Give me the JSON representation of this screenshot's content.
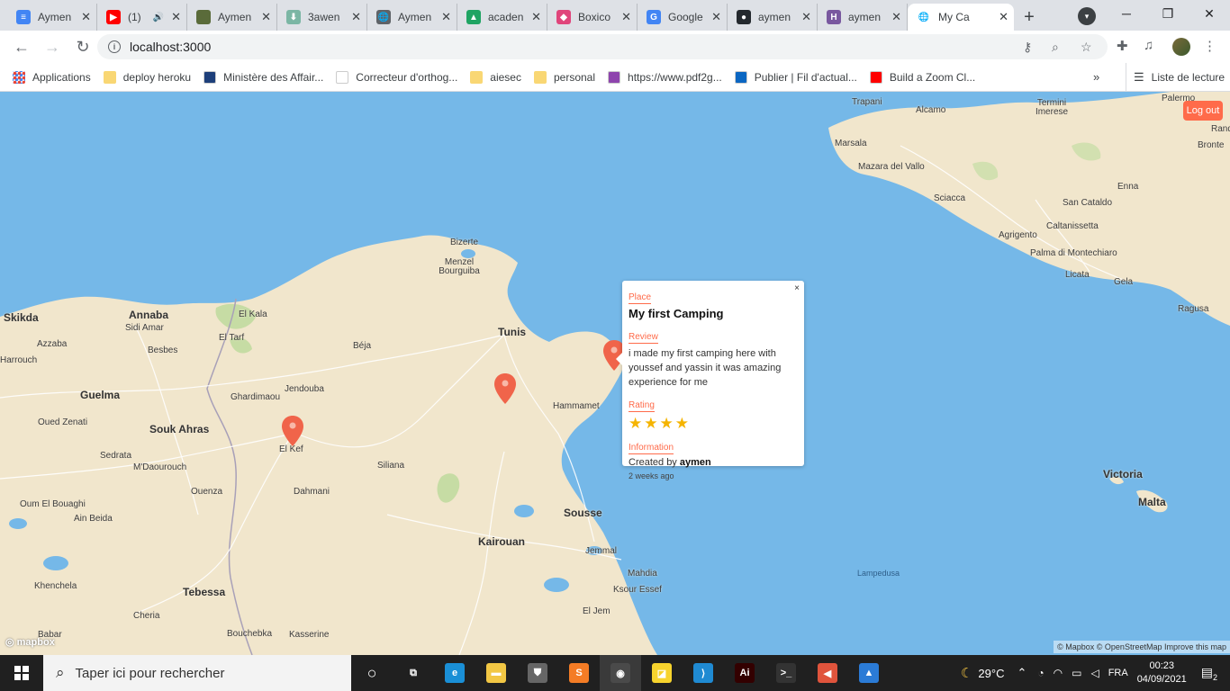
{
  "browser": {
    "tabs": [
      {
        "title": "Aymen",
        "fav_color": "#4285f4",
        "fav_glyph": "≡"
      },
      {
        "title": "(1)",
        "fav_color": "#ff0000",
        "fav_glyph": "▶",
        "audio": "🔊"
      },
      {
        "title": "Aymen",
        "fav_color": "#5a6b3a",
        "fav_glyph": ""
      },
      {
        "title": "3awen",
        "fav_color": "#7bb6a4",
        "fav_glyph": "⬇"
      },
      {
        "title": "Aymen",
        "fav_color": "#5f6368",
        "fav_glyph": "🌐"
      },
      {
        "title": "acaden",
        "fav_color": "#1fa463",
        "fav_glyph": "▲"
      },
      {
        "title": "Boxico",
        "fav_color": "#e0457b",
        "fav_glyph": "◆"
      },
      {
        "title": "Google",
        "fav_color": "#4285f4",
        "fav_glyph": "G"
      },
      {
        "title": "aymen",
        "fav_color": "#24292e",
        "fav_glyph": "●"
      },
      {
        "title": "aymen",
        "fav_color": "#79589f",
        "fav_glyph": "H"
      }
    ],
    "active_tab": {
      "title": "My Ca",
      "fav_glyph": "🌐"
    },
    "new_tab": "+",
    "tab_close": "✕",
    "url": "localhost:3000",
    "window_controls": {
      "minimize": "─",
      "restore": "❐",
      "close": "✕"
    }
  },
  "bookmarks": {
    "items": [
      {
        "label": "Applications",
        "kind": "apps"
      },
      {
        "label": "deploy heroku",
        "kind": "folder"
      },
      {
        "label": "Ministère des Affair...",
        "kind": "site",
        "color": "#1d3f7a"
      },
      {
        "label": "Correcteur d'orthog...",
        "kind": "site",
        "color": "#ffffff"
      },
      {
        "label": "aiesec",
        "kind": "folder"
      },
      {
        "label": "personal",
        "kind": "folder"
      },
      {
        "label": "https://www.pdf2g...",
        "kind": "site",
        "color": "#8e44ad"
      },
      {
        "label": "Publier | Fil d'actual...",
        "kind": "site",
        "color": "#0a66c2"
      },
      {
        "label": "Build a Zoom Cl...",
        "kind": "site",
        "color": "#ff0000"
      }
    ],
    "more": "»",
    "reading_list": "Liste de lecture"
  },
  "map": {
    "logout_label": "Log out",
    "places": [
      {
        "name": "Trapani",
        "cls": ""
      },
      {
        "name": "Alcamo",
        "cls": ""
      },
      {
        "name": "Termini Imerese",
        "cls": ""
      },
      {
        "name": "Palermo",
        "cls": ""
      },
      {
        "name": "Randa",
        "cls": ""
      },
      {
        "name": "Bronte",
        "cls": ""
      },
      {
        "name": "Marsala",
        "cls": ""
      },
      {
        "name": "Mazara del Vallo",
        "cls": ""
      },
      {
        "name": "Enna",
        "cls": ""
      },
      {
        "name": "Sciacca",
        "cls": ""
      },
      {
        "name": "San Cataldo",
        "cls": ""
      },
      {
        "name": "Caltanissetta",
        "cls": ""
      },
      {
        "name": "Agrigento",
        "cls": ""
      },
      {
        "name": "Palma di Montechiaro",
        "cls": ""
      },
      {
        "name": "Licata",
        "cls": ""
      },
      {
        "name": "Gela",
        "cls": ""
      },
      {
        "name": "Ragusa",
        "cls": ""
      },
      {
        "name": "Bizerte",
        "cls": ""
      },
      {
        "name": "Menzel Bourguiba",
        "cls": ""
      },
      {
        "name": "Skikda",
        "cls": "big"
      },
      {
        "name": "Annaba",
        "cls": "big"
      },
      {
        "name": "Sidi Amar",
        "cls": ""
      },
      {
        "name": "El Kala",
        "cls": ""
      },
      {
        "name": "El Tarf",
        "cls": ""
      },
      {
        "name": "Azzaba",
        "cls": ""
      },
      {
        "name": "Besbes",
        "cls": ""
      },
      {
        "name": "Béja",
        "cls": ""
      },
      {
        "name": "Tunis",
        "cls": "big"
      },
      {
        "name": "Harrouch",
        "cls": ""
      },
      {
        "name": "Guelma",
        "cls": "big"
      },
      {
        "name": "Ghardimaou",
        "cls": ""
      },
      {
        "name": "Jendouba",
        "cls": ""
      },
      {
        "name": "Hammamet",
        "cls": ""
      },
      {
        "name": "Oued Zenati",
        "cls": ""
      },
      {
        "name": "Souk Ahras",
        "cls": "big"
      },
      {
        "name": "El Kef",
        "cls": ""
      },
      {
        "name": "Sedrata",
        "cls": ""
      },
      {
        "name": "M'Daourouch",
        "cls": ""
      },
      {
        "name": "Siliana",
        "cls": ""
      },
      {
        "name": "Dahmani",
        "cls": ""
      },
      {
        "name": "Ouenza",
        "cls": ""
      },
      {
        "name": "Oum El Bouaghi",
        "cls": ""
      },
      {
        "name": "Ain Beida",
        "cls": ""
      },
      {
        "name": "Sousse",
        "cls": "big"
      },
      {
        "name": "Kairouan",
        "cls": "big"
      },
      {
        "name": "Jemmal",
        "cls": ""
      },
      {
        "name": "Mahdia",
        "cls": ""
      },
      {
        "name": "Khenchela",
        "cls": ""
      },
      {
        "name": "Tebessa",
        "cls": "big"
      },
      {
        "name": "Ksour Essef",
        "cls": ""
      },
      {
        "name": "Cheria",
        "cls": ""
      },
      {
        "name": "El Jem",
        "cls": ""
      },
      {
        "name": "Babar",
        "cls": ""
      },
      {
        "name": "Bouchebka",
        "cls": ""
      },
      {
        "name": "Kasserine",
        "cls": ""
      },
      {
        "name": "Victoria",
        "cls": "big"
      },
      {
        "name": "Malta",
        "cls": "big"
      },
      {
        "name": "Lampedusa",
        "cls": "sea"
      }
    ],
    "popup": {
      "close": "×",
      "place_label": "Place",
      "title": "My first Camping",
      "review_label": "Review",
      "review": "i made my first camping here with youssef and yassin it was amazing experience for me",
      "rating_label": "Rating",
      "rating": 4,
      "rating_max": 4,
      "info_label": "Information",
      "created_prefix": "Created by",
      "created_by": "aymen",
      "ago": "2 weeks ago"
    },
    "logo": "mapbox",
    "attribution": "© Mapbox © OpenStreetMap Improve this map",
    "pin_color": "#f0644a"
  },
  "taskbar": {
    "search_placeholder": "Taper ici pour rechercher",
    "apps": [
      {
        "name": "task-view",
        "glyph": "⧉",
        "color": "#202020"
      },
      {
        "name": "edge",
        "glyph": "e",
        "color": "#1a8fd6"
      },
      {
        "name": "file-explorer",
        "glyph": "▬",
        "color": "#f2c744"
      },
      {
        "name": "store",
        "glyph": "⛊",
        "color": "#666666"
      },
      {
        "name": "sublime",
        "glyph": "S",
        "color": "#f47c25"
      },
      {
        "name": "chrome",
        "glyph": "◉",
        "color": "#4a4a4a"
      },
      {
        "name": "sticky-notes",
        "glyph": "◪",
        "color": "#f7d32d"
      },
      {
        "name": "vscode",
        "glyph": "⟩",
        "color": "#1f8ad2"
      },
      {
        "name": "illustrator",
        "glyph": "Ai",
        "color": "#330000"
      },
      {
        "name": "terminal",
        "glyph": ">_",
        "color": "#333333"
      },
      {
        "name": "audio",
        "glyph": "◀",
        "color": "#e0543c"
      },
      {
        "name": "photos",
        "glyph": "▲",
        "color": "#2b7bd6"
      }
    ],
    "weather": "29°C",
    "lang": "FRA",
    "time": "00:23",
    "date": "04/09/2021",
    "notifications": "2"
  }
}
